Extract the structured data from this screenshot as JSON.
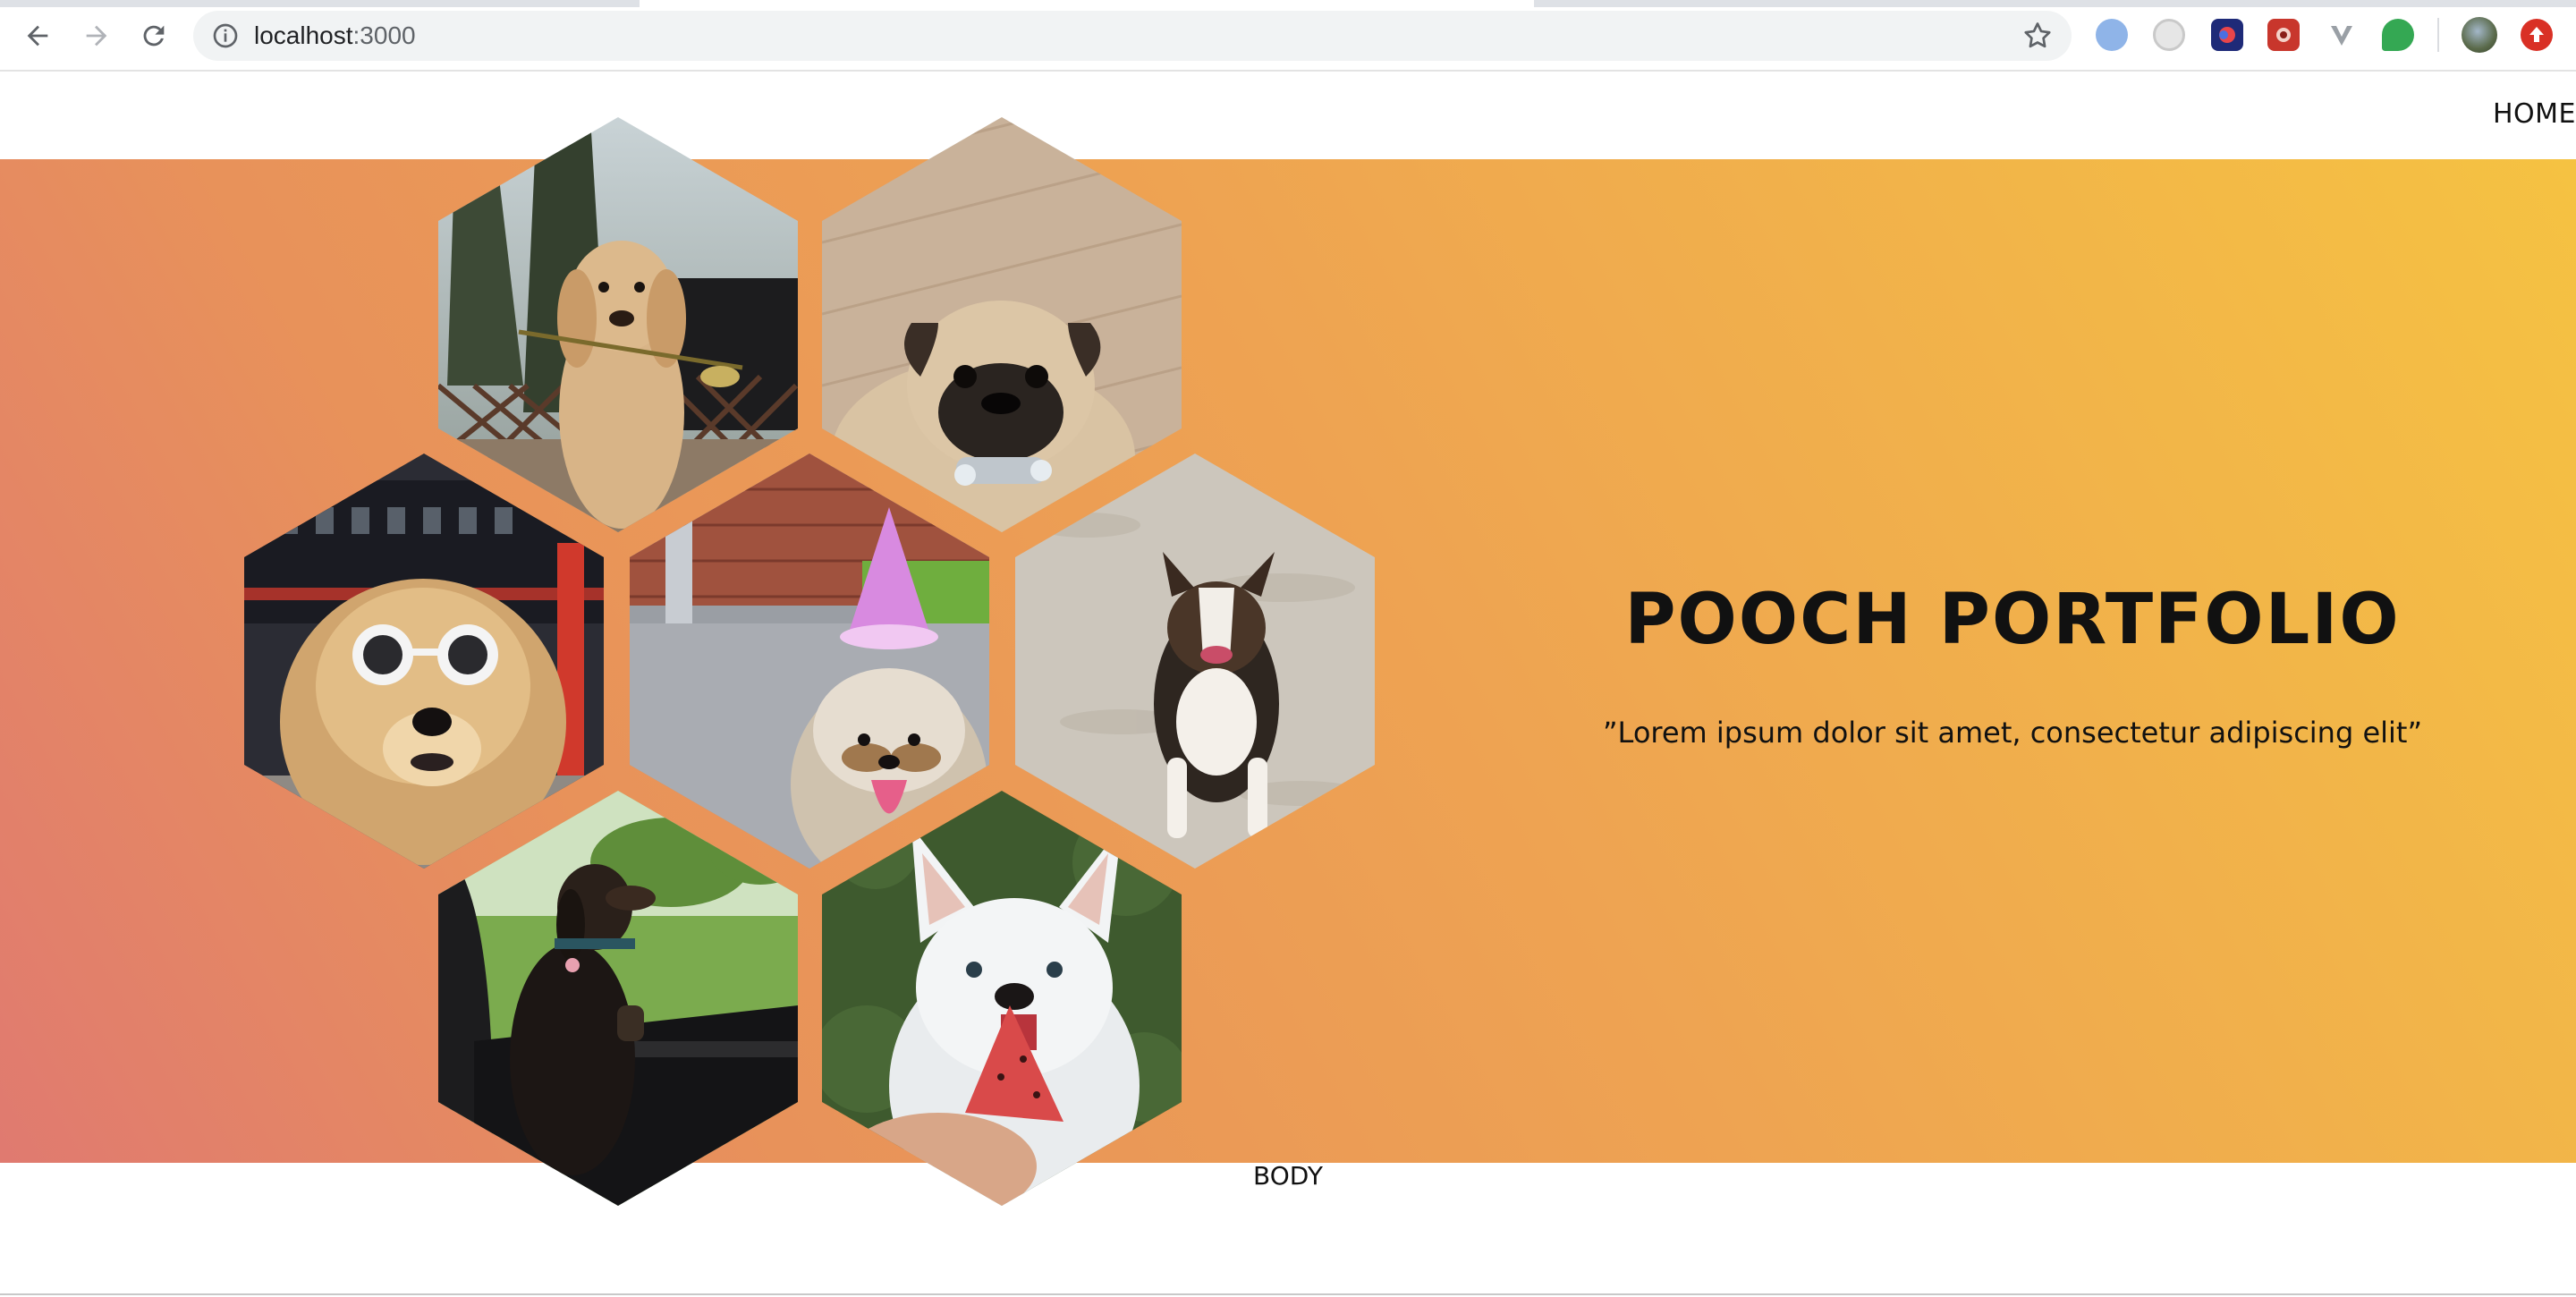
{
  "browser": {
    "url_host": "localhost",
    "url_port": ":3000",
    "icons": [
      "back-arrow-icon",
      "forward-arrow-icon",
      "reload-icon",
      "info-icon",
      "bookmark-star-icon"
    ],
    "extensions": [
      {
        "name": "extension-1-icon",
        "color": "#8fb4e8"
      },
      {
        "name": "extension-2-icon",
        "color": "#d8d8d8"
      },
      {
        "name": "extension-3-icon",
        "color": "#1e2a78"
      },
      {
        "name": "extension-4-icon",
        "color": "#c8362c"
      },
      {
        "name": "extension-5-icon",
        "color": "#9aa0a6"
      },
      {
        "name": "extension-6-icon",
        "color": "#34a853"
      },
      {
        "name": "profile-avatar-icon",
        "color": "#5a6a4a"
      },
      {
        "name": "update-icon",
        "color": "#d93025"
      }
    ]
  },
  "header": {
    "nav_home": "HOME"
  },
  "hero": {
    "title": "POOCH PORTFOLIO",
    "quote": "”Lorem ipsum dolor sit amet, consectetur adipiscing elit”",
    "gradient": [
      "#e07a70",
      "#eea352",
      "#f5c242"
    ],
    "photos": [
      "golden-retriever-with-flower",
      "pug-with-toy",
      "chow-chow-with-sunglasses",
      "yorkie-with-party-hat",
      "australian-shepherd-running",
      "dachshund-in-car",
      "husky-with-treat"
    ]
  },
  "footer": {
    "body_label": "BODY"
  }
}
